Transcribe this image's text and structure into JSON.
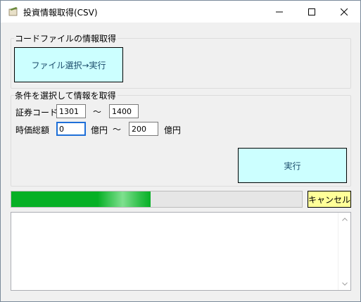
{
  "window": {
    "title": "投資情報取得(CSV)",
    "controls": [
      "minimize-icon",
      "maximize-icon",
      "close-icon"
    ]
  },
  "code_file_group": {
    "label": "コードファイルの情報取得",
    "select_button": "ファイル選択→実行"
  },
  "condition_group": {
    "label": "条件を選択して情報を取得",
    "code_label": "証券コード",
    "code_from": "1301",
    "code_sep": "〜",
    "code_to": "1400",
    "cap_label": "時価総額",
    "cap_from": "0",
    "unit1": "億円",
    "cap_sep": "〜",
    "cap_to": "200",
    "unit2": "億円",
    "run_button": "実行"
  },
  "progress": {
    "fraction": 0.48
  },
  "cancel_button": "キャンセル",
  "log": {
    "text": ""
  },
  "colors": {
    "button_cyan": "#ccffff",
    "cancel_yellow": "#ffff99",
    "progress_green": "#06b025",
    "focus_blue": "#1e6fd8"
  }
}
